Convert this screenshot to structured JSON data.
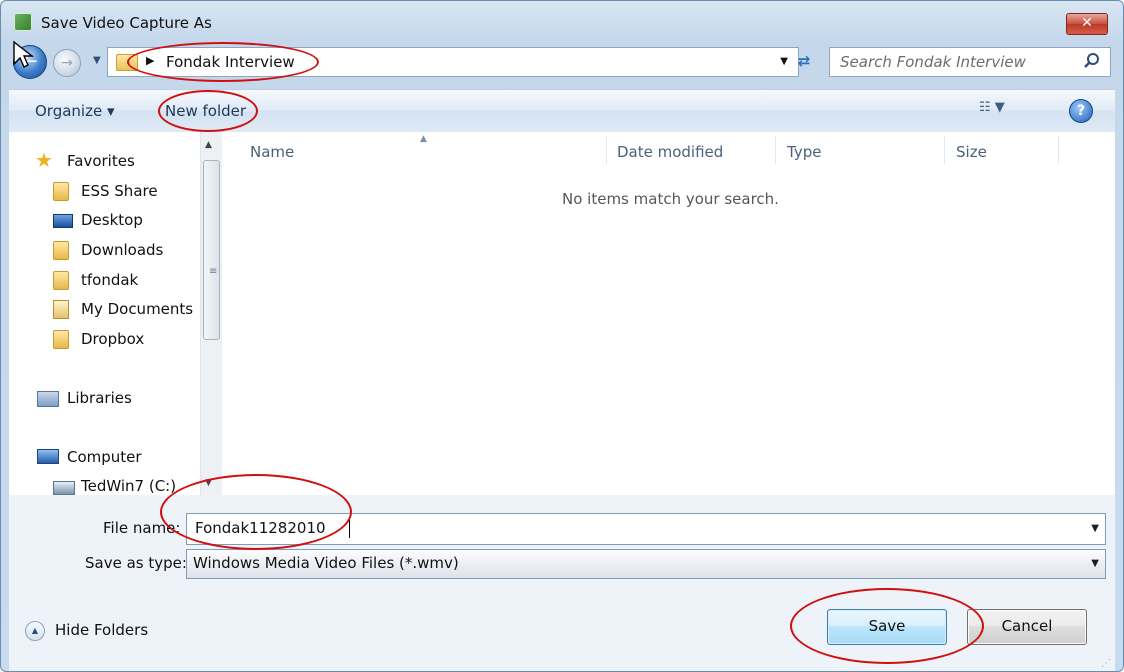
{
  "window": {
    "title": "Save Video Capture As",
    "close_glyph": "✕"
  },
  "nav": {
    "back_icon": "back-arrow-icon",
    "forward_icon": "forward-arrow-icon",
    "address_path": "Fondak Interview",
    "search_placeholder": "Search Fondak Interview"
  },
  "toolbar": {
    "organize_label": "Organize ▾",
    "new_folder_label": "New folder",
    "help_glyph": "?"
  },
  "sidebar": {
    "items": [
      {
        "label": "Favorites",
        "icon": "star-icon"
      },
      {
        "label": "ESS Share",
        "icon": "folder-icon"
      },
      {
        "label": "Desktop",
        "icon": "desktop-icon"
      },
      {
        "label": "Downloads",
        "icon": "downloads-folder-icon"
      },
      {
        "label": "tfondak",
        "icon": "folder-icon"
      },
      {
        "label": "My Documents",
        "icon": "documents-icon"
      },
      {
        "label": "Dropbox",
        "icon": "dropbox-folder-icon"
      },
      {
        "label": "Libraries",
        "icon": "libraries-icon"
      },
      {
        "label": "Computer",
        "icon": "computer-icon"
      },
      {
        "label": "TedWin7 (C:)",
        "icon": "drive-icon"
      }
    ]
  },
  "files": {
    "columns": [
      "Name",
      "Date modified",
      "Type",
      "Size"
    ],
    "empty_message": "No items match your search."
  },
  "form": {
    "file_name_label": "File name:",
    "file_name_value": "Fondak11282010",
    "save_as_type_label": "Save as type:",
    "save_as_type_value": "Windows Media Video Files (*.wmv)"
  },
  "footer": {
    "hide_folders_label": "Hide Folders",
    "save_label": "Save",
    "cancel_label": "Cancel"
  },
  "colors": {
    "annotation": "#d20f0f",
    "chrome": "#c4d7eb",
    "accent": "#3c7fb1"
  }
}
